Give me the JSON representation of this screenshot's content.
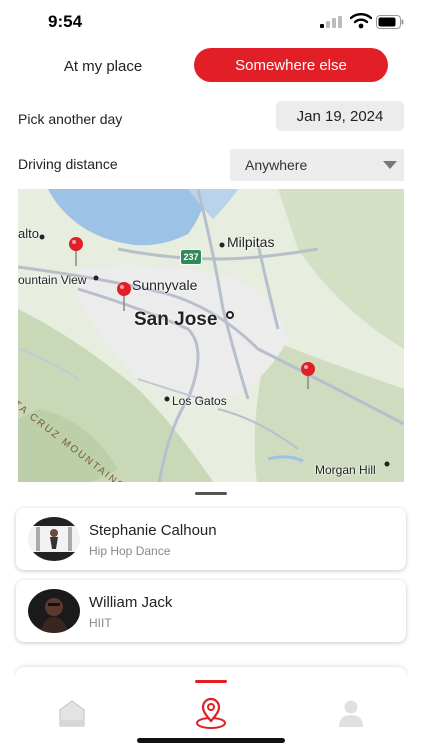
{
  "status_bar": {
    "time": "9:54"
  },
  "mode": {
    "left_label": "At my place",
    "right_label": "Somewhere else",
    "selected": "Somewhere else"
  },
  "date": {
    "label": "Pick another day",
    "value": "Jan 19, 2024"
  },
  "distance": {
    "label": "Driving distance",
    "value": "Anywhere"
  },
  "map": {
    "labels": {
      "alto": "alto",
      "mountain_view": "ountain View",
      "sunnyvale": "Sunnyvale",
      "san_jose": "San Jose",
      "milpitas": "Milpitas",
      "los_gatos": "Los Gatos",
      "morgan_hill": "Morgan Hill",
      "highway": "237",
      "santa_cruz_mountains": "TA CRUZ MOUNTAINS"
    },
    "pin_color": "#e21e26"
  },
  "instructors": [
    {
      "name": "Stephanie Calhoun",
      "class": "Hip Hop Dance"
    },
    {
      "name": "William Jack",
      "class": "HIIT"
    }
  ],
  "tabs": [
    {
      "icon": "home-icon",
      "active": false
    },
    {
      "icon": "map-pin-icon",
      "active": true
    },
    {
      "icon": "profile-icon",
      "active": false
    }
  ],
  "colors": {
    "accent": "#e21e26"
  }
}
